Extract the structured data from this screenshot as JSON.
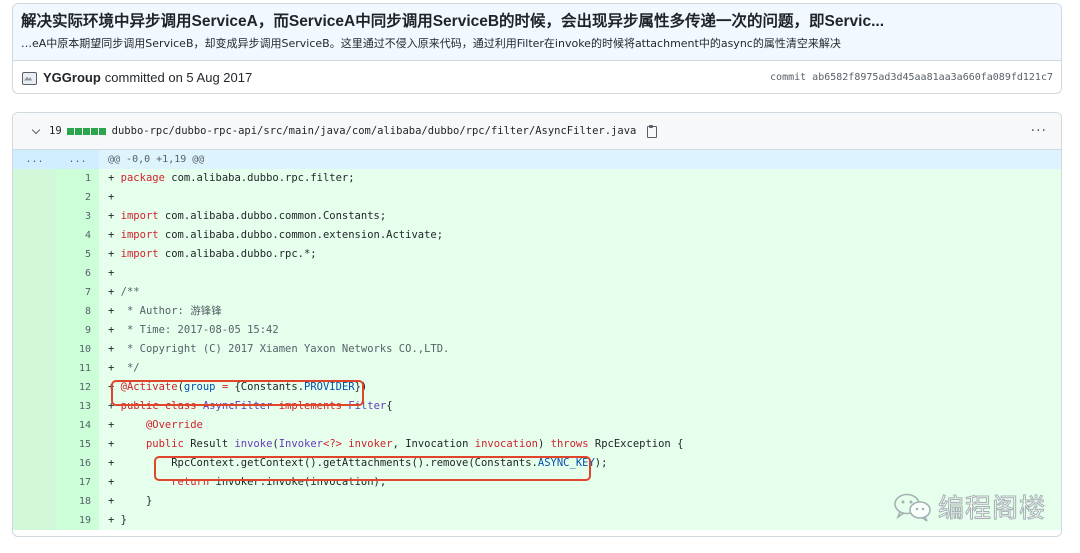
{
  "commit": {
    "title": "解决实际环境中异步调用ServiceA，而ServiceA中同步调用ServiceB的时候，会出现异步属性多传递一次的问题，即Servic...",
    "description": "…eA中原本期望同步调用ServiceB，却变成异步调用ServiceB。这里通过不侵入原来代码，通过利用Filter在invoke的时候将attachment中的async的属性清空来解决",
    "author": "YGGroup",
    "committed_text": "committed on 5 Aug 2017",
    "sha_text": "commit ab6582f8975ad3d45aa81aa3a660fa089fd121c7"
  },
  "file": {
    "changes": "19",
    "path": "dubbo-rpc/dubbo-rpc-api/src/main/java/com/alibaba/dubbo/rpc/filter/AsyncFilter.java",
    "more": "···"
  },
  "hunk": {
    "old_gutter": "...",
    "new_gutter": "...",
    "header": "@@ -0,0 +1,19 @@"
  },
  "lines": [
    {
      "n": "1",
      "tokens": [
        [
          "k",
          "package"
        ],
        [
          "",
          " com.alibaba.dubbo.rpc.filter;"
        ]
      ]
    },
    {
      "n": "2",
      "tokens": []
    },
    {
      "n": "3",
      "tokens": [
        [
          "k",
          "import"
        ],
        [
          "",
          " com.alibaba.dubbo.common.Constants;"
        ]
      ]
    },
    {
      "n": "4",
      "tokens": [
        [
          "k",
          "import"
        ],
        [
          "",
          " com.alibaba.dubbo.common.extension.Activate;"
        ]
      ]
    },
    {
      "n": "5",
      "tokens": [
        [
          "k",
          "import"
        ],
        [
          "",
          " com.alibaba.dubbo.rpc.*;"
        ]
      ]
    },
    {
      "n": "6",
      "tokens": []
    },
    {
      "n": "7",
      "tokens": [
        [
          "c",
          "/**"
        ]
      ]
    },
    {
      "n": "8",
      "tokens": [
        [
          "c",
          " * Author: 游锋锋"
        ]
      ]
    },
    {
      "n": "9",
      "tokens": [
        [
          "c",
          " * Time: 2017-08-05 15:42"
        ]
      ]
    },
    {
      "n": "10",
      "tokens": [
        [
          "c",
          " * Copyright (C) 2017 Xiamen Yaxon Networks CO.,LTD."
        ]
      ]
    },
    {
      "n": "11",
      "tokens": [
        [
          "c",
          " */"
        ]
      ]
    },
    {
      "n": "12",
      "tokens": [
        [
          "k",
          "@Activate"
        ],
        [
          "",
          "("
        ],
        [
          "e",
          "group"
        ],
        [
          "",
          " "
        ],
        [
          "k",
          "="
        ],
        [
          "",
          " {Constants."
        ],
        [
          "e",
          "PROVIDER"
        ],
        [
          "",
          "})"
        ]
      ]
    },
    {
      "n": "13",
      "tokens": [
        [
          "k",
          "public"
        ],
        [
          "",
          " "
        ],
        [
          "k",
          "class"
        ],
        [
          "",
          " "
        ],
        [
          "f",
          "AsyncFilter"
        ],
        [
          "",
          " "
        ],
        [
          "k",
          "implements"
        ],
        [
          "",
          " "
        ],
        [
          "f",
          "Filter"
        ],
        [
          "",
          "{"
        ]
      ]
    },
    {
      "n": "14",
      "tokens": [
        [
          "",
          "    "
        ],
        [
          "k",
          "@Override"
        ]
      ]
    },
    {
      "n": "15",
      "tokens": [
        [
          "",
          "    "
        ],
        [
          "k",
          "public"
        ],
        [
          "",
          " Result "
        ],
        [
          "f",
          "invoke"
        ],
        [
          "",
          "("
        ],
        [
          "f",
          "Invoker"
        ],
        [
          "k",
          "<?>"
        ],
        [
          "",
          " "
        ],
        [
          "k",
          "invoker"
        ],
        [
          "",
          ", Invocation "
        ],
        [
          "k",
          "invocation"
        ],
        [
          "",
          ") "
        ],
        [
          "k",
          "throws"
        ],
        [
          "",
          " RpcException {"
        ]
      ]
    },
    {
      "n": "16",
      "tokens": [
        [
          "",
          "        RpcContext.getContext().getAttachments().remove(Constants."
        ],
        [
          "e",
          "ASYNC_KEY"
        ],
        [
          "",
          ");"
        ]
      ]
    },
    {
      "n": "17",
      "tokens": [
        [
          "",
          "        "
        ],
        [
          "k",
          "return"
        ],
        [
          "",
          " invoker.invoke(invocation);"
        ]
      ]
    },
    {
      "n": "18",
      "tokens": [
        [
          "",
          "    }"
        ]
      ]
    },
    {
      "n": "19",
      "tokens": [
        [
          "",
          "}"
        ]
      ]
    }
  ],
  "watermark": {
    "text": "编程阁楼"
  },
  "colors": {
    "addition_bg": "#e6ffec",
    "highlight_border": "#e0452b",
    "keyword": "#cf222e"
  }
}
